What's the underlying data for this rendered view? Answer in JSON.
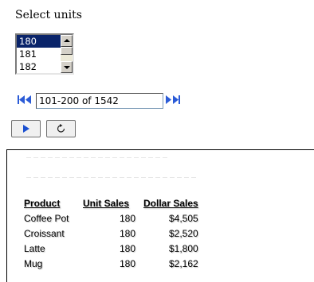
{
  "title": "Select units",
  "listbox": {
    "items": [
      "180",
      "181",
      "182"
    ],
    "selected": "180"
  },
  "pager": {
    "value": "101-200 of 1542",
    "icons": [
      "first-page-icon",
      "previous-page-icon",
      "next-page-icon",
      "last-page-icon"
    ]
  },
  "buttons": {
    "run_icon": "play-icon",
    "reset_icon": "refresh-icon"
  },
  "report": {
    "headers": [
      "Product",
      "Unit Sales",
      "Dollar Sales"
    ],
    "rows": [
      [
        "Coffee Pot",
        "180",
        "$4,505"
      ],
      [
        "Croissant",
        "180",
        "$2,520"
      ],
      [
        "Latte",
        "180",
        "$1,800"
      ],
      [
        "Mug",
        "180",
        "$2,162"
      ]
    ]
  },
  "colors": {
    "selection": "#0a246a",
    "pager_icon": "#2b5bd7",
    "run_icon": "#1a4fd0"
  }
}
